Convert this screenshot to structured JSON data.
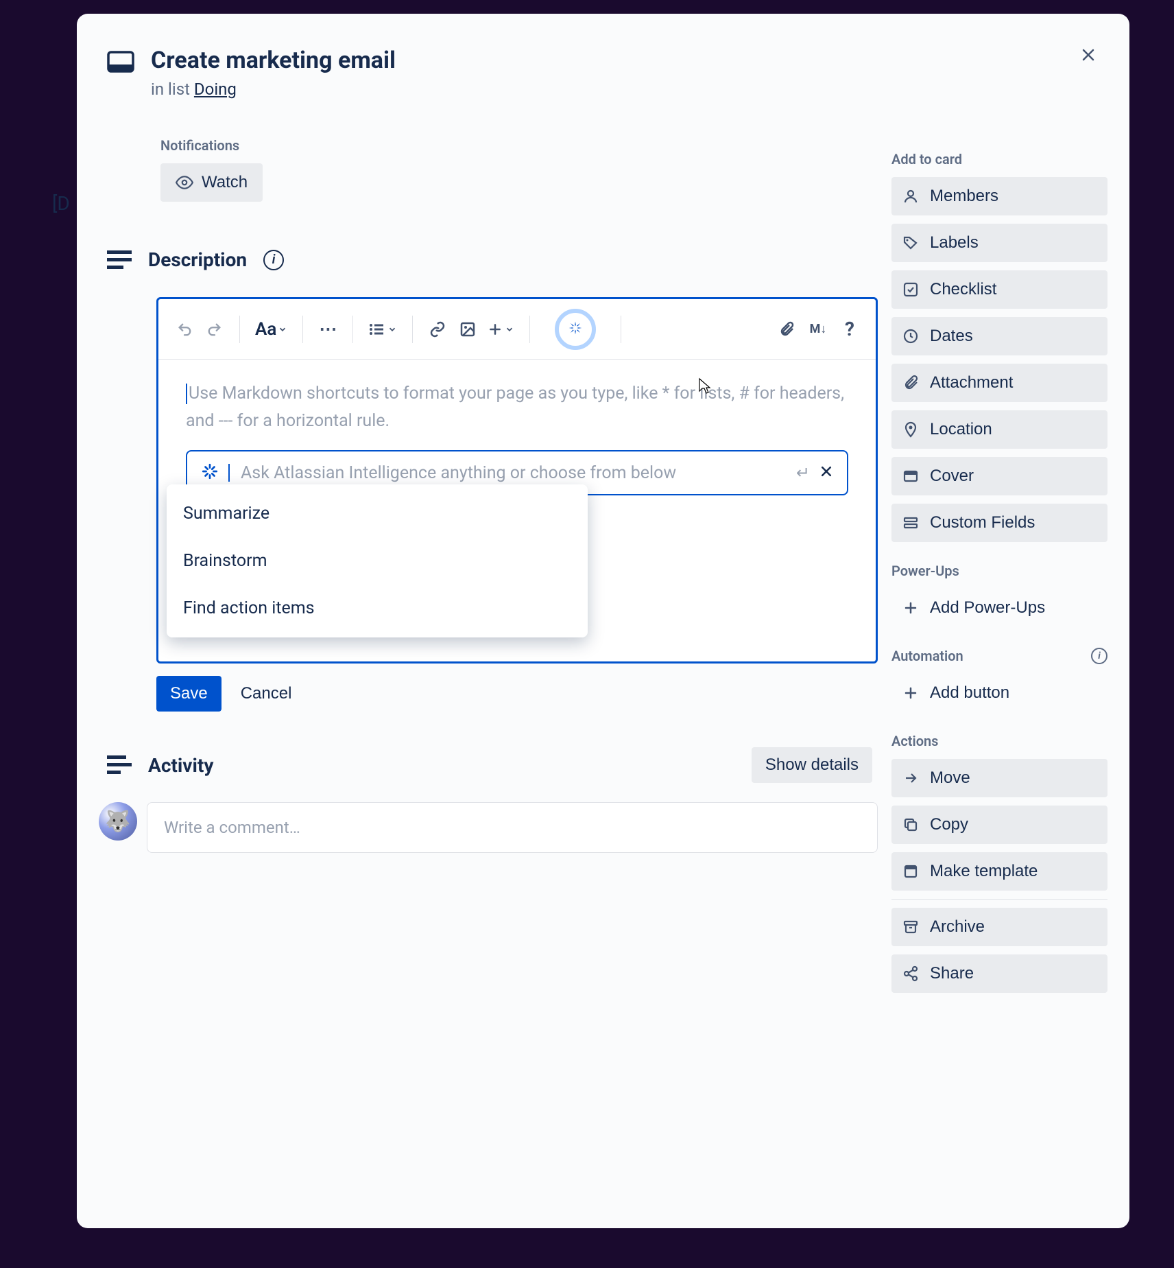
{
  "backdrop": {
    "text": "[D"
  },
  "card": {
    "title": "Create marketing email",
    "list_prefix": "in list ",
    "list_name": "Doing"
  },
  "notifications": {
    "heading": "Notifications",
    "watch": "Watch"
  },
  "description": {
    "heading": "Description",
    "placeholder": "Use Markdown shortcuts to format your page as you type, like * for lists, # for headers, and --- for a horizontal rule.",
    "ai_placeholder": "Ask Atlassian Intelligence anything or choose from below",
    "suggestions": [
      "Summarize",
      "Brainstorm",
      "Find action items"
    ],
    "save": "Save",
    "cancel": "Cancel"
  },
  "toolbar": {
    "text_styles": "Aa"
  },
  "activity": {
    "heading": "Activity",
    "show_details": "Show details",
    "comment_placeholder": "Write a comment…"
  },
  "sidebar": {
    "add_to_card": {
      "heading": "Add to card",
      "items": [
        "Members",
        "Labels",
        "Checklist",
        "Dates",
        "Attachment",
        "Location",
        "Cover",
        "Custom Fields"
      ]
    },
    "powerups": {
      "heading": "Power-Ups",
      "add": "Add Power-Ups"
    },
    "automation": {
      "heading": "Automation",
      "add": "Add button"
    },
    "actions": {
      "heading": "Actions",
      "items": [
        "Move",
        "Copy",
        "Make template",
        "Archive",
        "Share"
      ]
    }
  }
}
